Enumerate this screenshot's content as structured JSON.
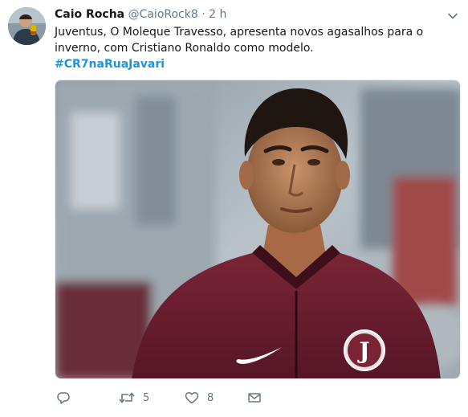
{
  "tweet": {
    "author_name": "Caio Rocha",
    "handle": "@CaioRock8",
    "separator": "·",
    "time": "2 h",
    "text": "Juventus, O Moleque Travesso, apresenta novos agasalhos para o inverno, com Cristiano Ronaldo como modelo.",
    "hashtag": "#CR7naRuaJavari"
  },
  "actions": {
    "reply_count": "",
    "retweet_count": "5",
    "like_count": "8"
  },
  "crest_letter": "J",
  "icons": {
    "reply": "reply-icon",
    "retweet": "retweet-icon",
    "like": "heart-icon",
    "dm": "envelope-icon",
    "caret": "chevron-down-icon"
  },
  "colors": {
    "link": "#1b95e0",
    "secondary_text": "#657786",
    "jacket": "#6b1f2f"
  }
}
